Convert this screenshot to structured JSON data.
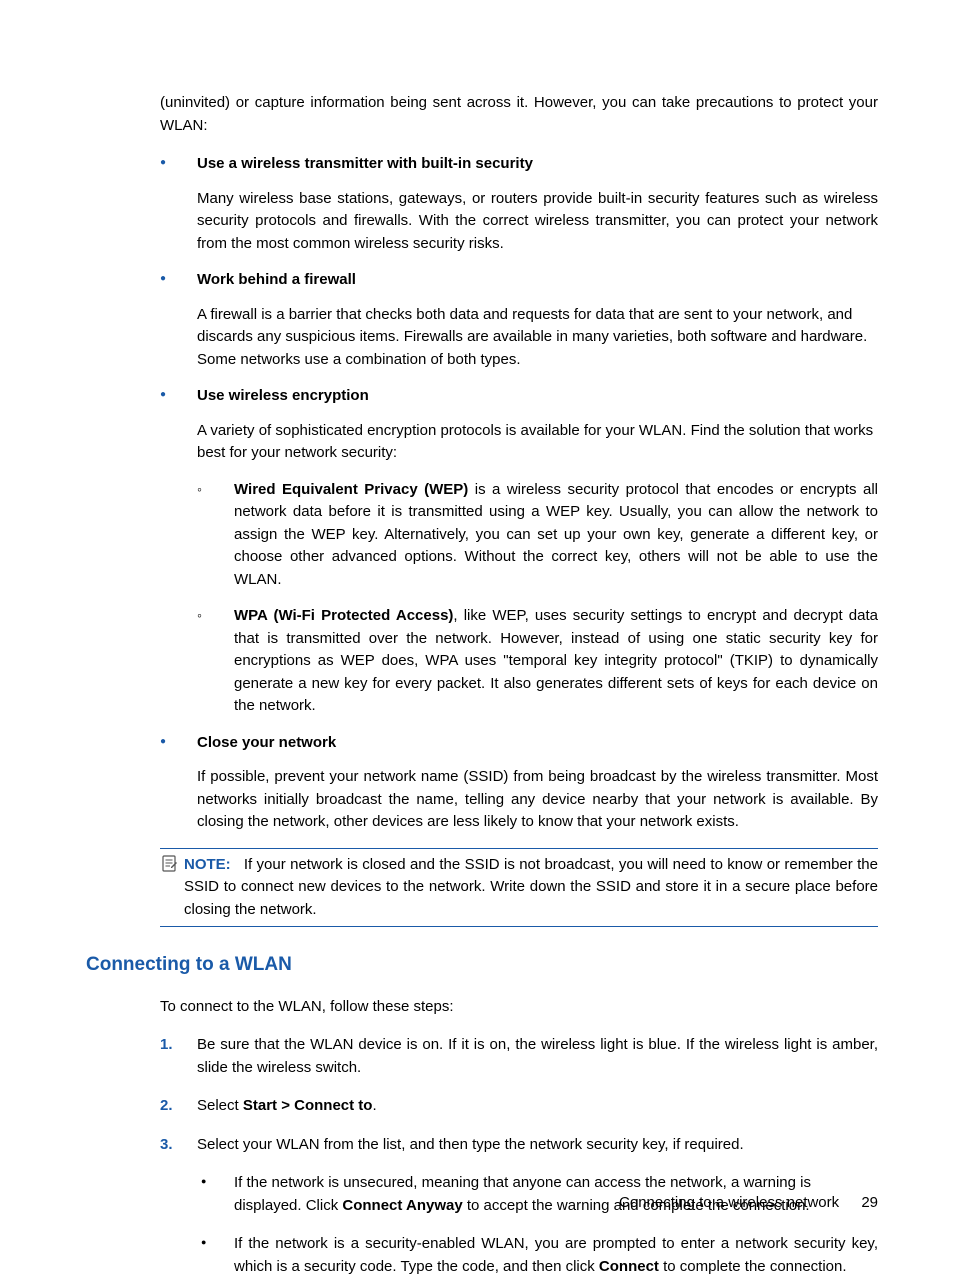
{
  "intro": "(uninvited) or capture information being sent across it. However, you can take precautions to protect your WLAN:",
  "items": [
    {
      "title": "Use a wireless transmitter with built-in security",
      "body": "Many wireless base stations, gateways, or routers provide built-in security features such as wireless security protocols and firewalls. With the correct wireless transmitter, you can protect your network from the most common wireless security risks."
    },
    {
      "title": "Work behind a firewall",
      "body": "A firewall is a barrier that checks both data and requests for data that are sent to your network, and discards any suspicious items. Firewalls are available in many varieties, both software and hardware. Some networks use a combination of both types."
    },
    {
      "title": "Use wireless encryption",
      "body": "A variety of sophisticated encryption protocols is available for your WLAN. Find the solution that works best for your network security:",
      "sub": [
        {
          "lead": "Wired Equivalent Privacy (WEP)",
          "rest": " is a wireless security protocol that encodes or encrypts all network data before it is transmitted using a WEP key. Usually, you can allow the network to assign the WEP key. Alternatively, you can set up your own key, generate a different key, or choose other advanced options. Without the correct key, others will not be able to use the WLAN."
        },
        {
          "lead": "WPA (Wi-Fi Protected Access)",
          "rest": ", like WEP, uses security settings to encrypt and decrypt data that is transmitted over the network. However, instead of using one static security key for encryptions as WEP does, WPA uses \"temporal key integrity protocol\" (TKIP) to dynamically generate a new key for every packet. It also generates different sets of keys for each device on the network."
        }
      ]
    },
    {
      "title": "Close your network",
      "body": "If possible, prevent your network name (SSID) from being broadcast by the wireless transmitter. Most networks initially broadcast the name, telling any device nearby that your network is available. By closing the network, other devices are less likely to know that your network exists."
    }
  ],
  "note": {
    "label": "NOTE:",
    "text": "If your network is closed and the SSID is not broadcast, you will need to know or remember the SSID to connect new devices to the network. Write down the SSID and store it in a secure place before closing the network."
  },
  "section": {
    "title": "Connecting to a WLAN",
    "intro": "To connect to the WLAN, follow these steps:",
    "steps": {
      "s1": "Be sure that the WLAN device is on. If it is on, the wireless light is blue. If the wireless light is amber, slide the wireless switch.",
      "s2a": "Select ",
      "s2b": "Start > Connect to",
      "s2c": ".",
      "s3": "Select your WLAN from the list, and then type the network security key, if required.",
      "s3sub": {
        "a1": "If the network is unsecured, meaning that anyone can access the network, a warning is displayed. Click ",
        "a2": "Connect Anyway",
        "a3": " to accept the warning and complete the connection.",
        "b1": "If the network is a security-enabled WLAN, you are prompted to enter a network security key, which is a security code. Type the code, and then click ",
        "b2": "Connect",
        "b3": " to complete the connection."
      }
    }
  },
  "footer": {
    "text": "Connecting to a wireless network",
    "page": "29"
  }
}
